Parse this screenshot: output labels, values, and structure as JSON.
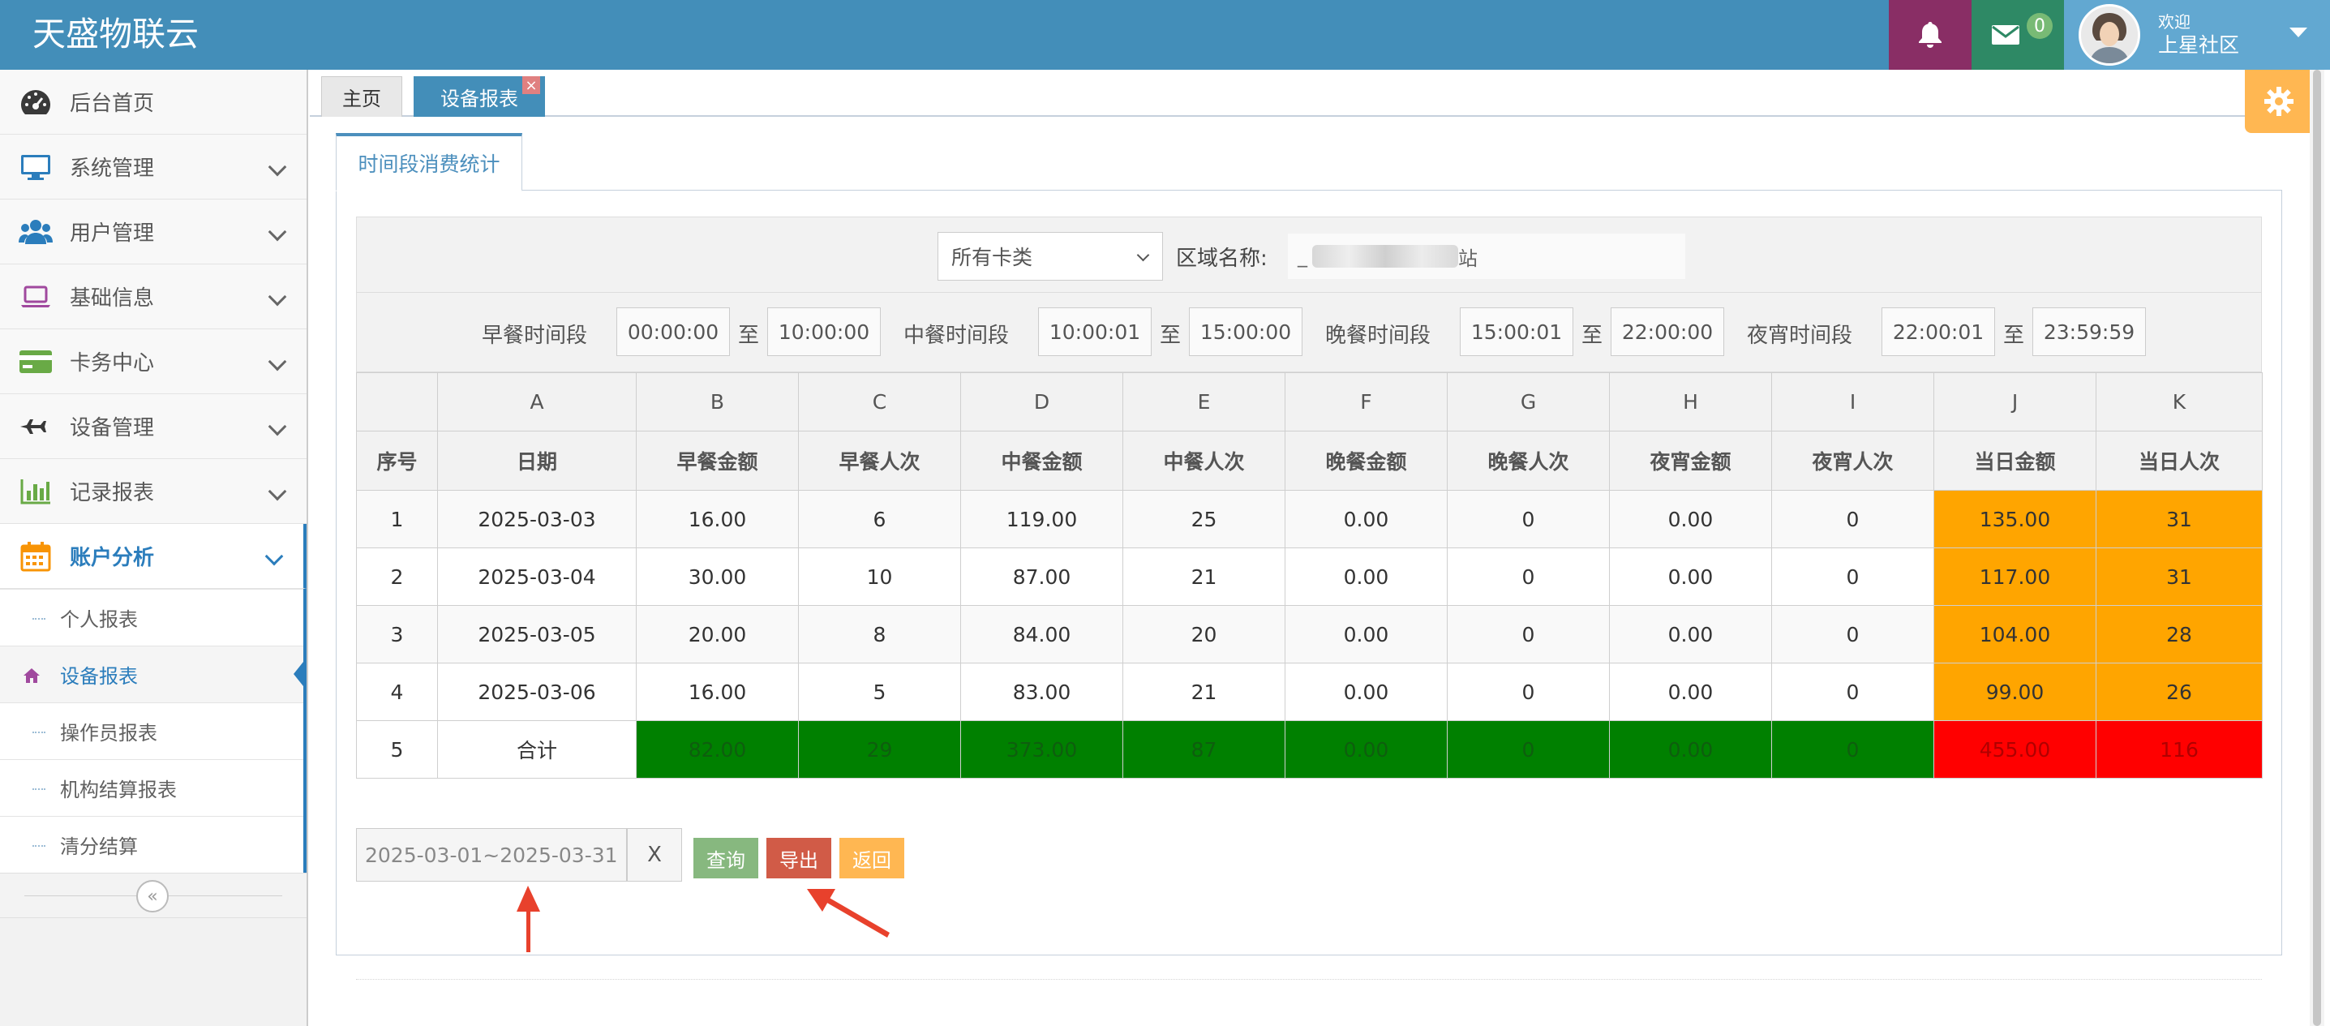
{
  "app": {
    "title": "天盛物联云"
  },
  "header": {
    "mail_count": "0",
    "welcome": "欢迎",
    "user_name": "上星社区"
  },
  "sidebar": {
    "items": [
      {
        "label": "后台首页",
        "icon": "dashboard-icon"
      },
      {
        "label": "系统管理",
        "icon": "desktop-icon"
      },
      {
        "label": "用户管理",
        "icon": "users-icon"
      },
      {
        "label": "基础信息",
        "icon": "laptop-icon"
      },
      {
        "label": "卡务中心",
        "icon": "credit-card-icon"
      },
      {
        "label": "设备管理",
        "icon": "plane-icon"
      },
      {
        "label": "记录报表",
        "icon": "bar-chart-icon"
      },
      {
        "label": "账户分析",
        "icon": "calendar-icon"
      }
    ],
    "submenu": [
      {
        "label": "个人报表"
      },
      {
        "label": "设备报表"
      },
      {
        "label": "操作员报表"
      },
      {
        "label": "机构结算报表"
      },
      {
        "label": "清分结算"
      }
    ]
  },
  "tabs": {
    "home": "主页",
    "current": "设备报表",
    "close": "×"
  },
  "panel": {
    "tab_label": "时间段消费统计"
  },
  "filters": {
    "card_type": "所有卡类",
    "area_label": "区域名称:",
    "area_value_prefix": "_",
    "area_value_suffix": "站",
    "to": "至",
    "segments": [
      {
        "label": "早餐时间段",
        "start": "00:00:00",
        "end": "10:00:00"
      },
      {
        "label": "中餐时间段",
        "start": "10:00:01",
        "end": "15:00:00"
      },
      {
        "label": "晚餐时间段",
        "start": "15:00:01",
        "end": "22:00:00"
      },
      {
        "label": "夜宵时间段",
        "start": "22:00:01",
        "end": "23:59:59"
      }
    ]
  },
  "table": {
    "letters": [
      "",
      "A",
      "B",
      "C",
      "D",
      "E",
      "F",
      "G",
      "H",
      "I",
      "J",
      "K"
    ],
    "headers": [
      "序号",
      "日期",
      "早餐金额",
      "早餐人次",
      "中餐金额",
      "中餐人次",
      "晚餐金额",
      "晚餐人次",
      "夜宵金额",
      "夜宵人次",
      "当日金额",
      "当日人次"
    ],
    "rows": [
      [
        "1",
        "2025-03-03",
        "16.00",
        "6",
        "119.00",
        "25",
        "0.00",
        "0",
        "0.00",
        "0",
        "135.00",
        "31"
      ],
      [
        "2",
        "2025-03-04",
        "30.00",
        "10",
        "87.00",
        "21",
        "0.00",
        "0",
        "0.00",
        "0",
        "117.00",
        "31"
      ],
      [
        "3",
        "2025-03-05",
        "20.00",
        "8",
        "84.00",
        "20",
        "0.00",
        "0",
        "0.00",
        "0",
        "104.00",
        "28"
      ],
      [
        "4",
        "2025-03-06",
        "16.00",
        "5",
        "83.00",
        "21",
        "0.00",
        "0",
        "0.00",
        "0",
        "99.00",
        "26"
      ]
    ],
    "total": [
      "5",
      "合计",
      "82.00",
      "29",
      "373.00",
      "87",
      "0.00",
      "0",
      "0.00",
      "0",
      "455.00",
      "116"
    ]
  },
  "actions": {
    "date_range": "2025-03-01~2025-03-31",
    "clear": "X",
    "query": "查询",
    "export": "导出",
    "back": "返回"
  },
  "colors": {
    "header_bg": "#438eb9",
    "highlight_orange": "#ffa500",
    "total_green": "#008000",
    "total_red": "#ff0000",
    "annotation_arrow": "#e8412c"
  }
}
